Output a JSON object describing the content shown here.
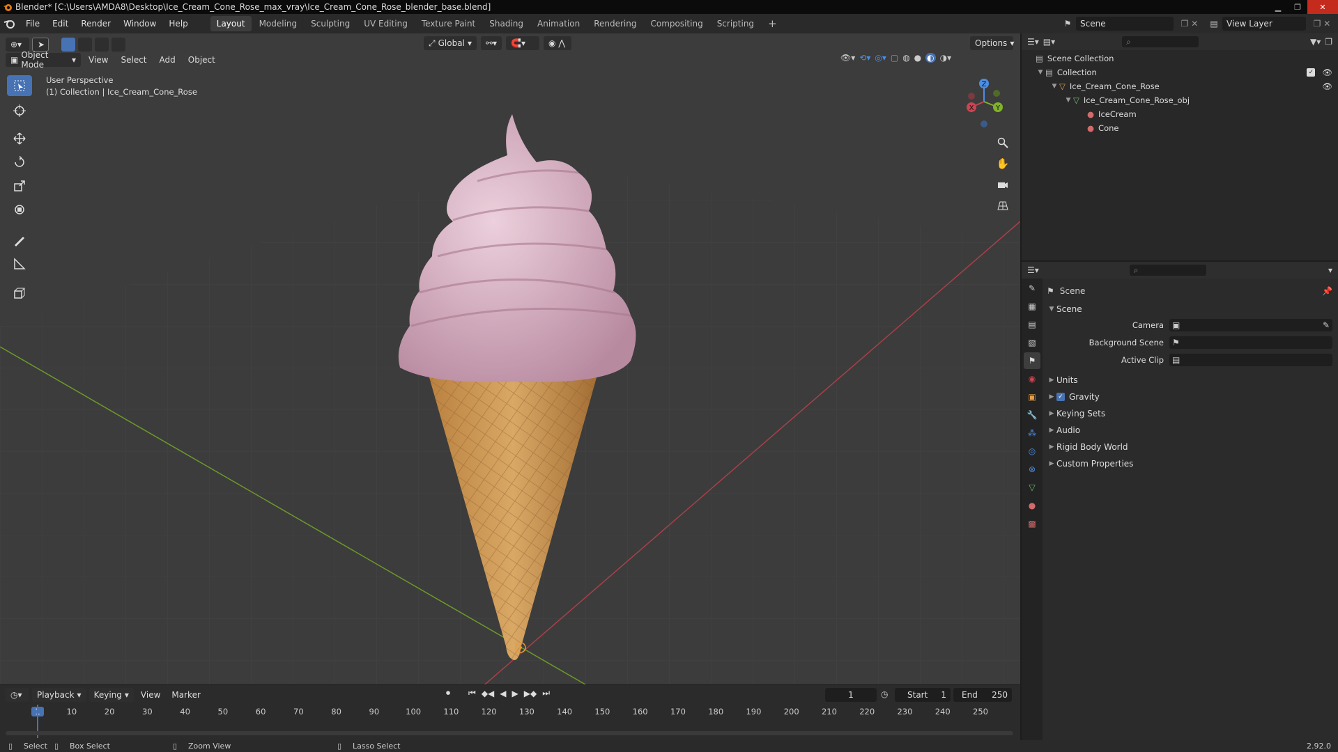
{
  "title": "Blender* [C:\\Users\\AMDA8\\Desktop\\Ice_Cream_Cone_Rose_max_vray\\Ice_Cream_Cone_Rose_blender_base.blend]",
  "menu": [
    "File",
    "Edit",
    "Render",
    "Window",
    "Help"
  ],
  "workspaces": [
    "Layout",
    "Modeling",
    "Sculpting",
    "UV Editing",
    "Texture Paint",
    "Shading",
    "Animation",
    "Rendering",
    "Compositing",
    "Scripting"
  ],
  "active_workspace": "Layout",
  "scene_name": "Scene",
  "view_layer": "View Layer",
  "viewport": {
    "mode": "Object Mode",
    "menus": [
      "View",
      "Select",
      "Add",
      "Object"
    ],
    "transform_orientation": "Global",
    "options": "Options",
    "perspective": "User Perspective",
    "collection_info": "(1) Collection | Ice_Cream_Cone_Rose",
    "gizmo": {
      "x": "X",
      "y": "Y",
      "z": "Z"
    }
  },
  "timeline": {
    "menus": [
      "Playback",
      "Keying",
      "View",
      "Marker"
    ],
    "current_frame": "1",
    "start_label": "Start",
    "start": "1",
    "end_label": "End",
    "end": "250",
    "ticks": [
      "1",
      "10",
      "20",
      "30",
      "40",
      "50",
      "60",
      "70",
      "80",
      "90",
      "100",
      "110",
      "120",
      "130",
      "140",
      "150",
      "160",
      "170",
      "180",
      "190",
      "200",
      "210",
      "220",
      "230",
      "240",
      "250"
    ]
  },
  "status": {
    "select": "Select",
    "box_select": "Box Select",
    "zoom_view": "Zoom View",
    "lasso_select": "Lasso Select",
    "version": "2.92.0"
  },
  "outliner": {
    "scene_collection": "Scene Collection",
    "items": [
      {
        "label": "Collection",
        "depth": 1
      },
      {
        "label": "Ice_Cream_Cone_Rose",
        "depth": 2
      },
      {
        "label": "Ice_Cream_Cone_Rose_obj",
        "depth": 3
      },
      {
        "label": "IceCream",
        "depth": 4
      },
      {
        "label": "Cone",
        "depth": 4
      }
    ]
  },
  "properties": {
    "context": "Scene",
    "panel": "Scene",
    "fields": [
      {
        "label": "Camera"
      },
      {
        "label": "Background Scene"
      },
      {
        "label": "Active Clip"
      }
    ],
    "subpanels": [
      "Units",
      "Gravity",
      "Keying Sets",
      "Audio",
      "Rigid Body World",
      "Custom Properties"
    ],
    "gravity_checked": true
  },
  "colors": {
    "accent": "#4772b3",
    "x_axis": "#c94552",
    "y_axis": "#80b32a",
    "z_axis": "#4d8ee3",
    "ice_cream": "#d9b3c5",
    "cone": "#c9924f"
  }
}
